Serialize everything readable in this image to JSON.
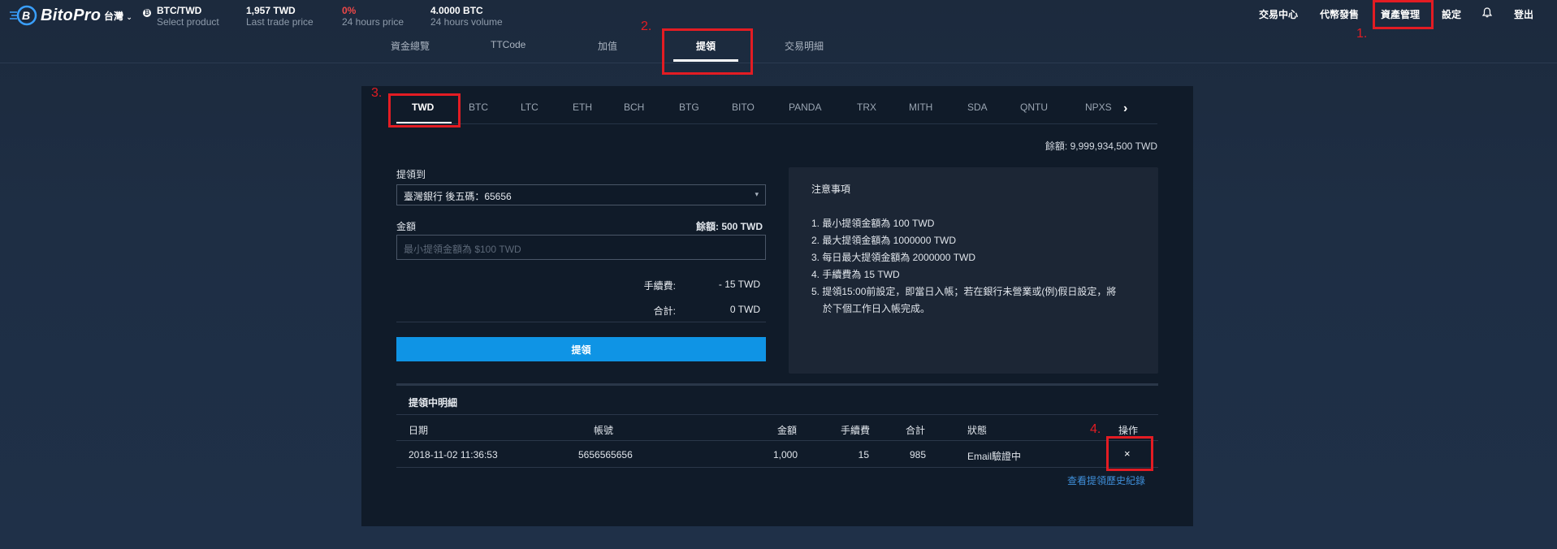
{
  "header": {
    "brand": "BitoPro",
    "region": "台灣",
    "pair": "BTC/TWD",
    "pair_sub": "Select product",
    "last_trade_value": "1,957 TWD",
    "last_trade_label": "Last trade price",
    "change_value": "0%",
    "change_label": "24 hours price",
    "volume_value": "4.0000 BTC",
    "volume_label": "24 hours volume",
    "nav": [
      "交易中心",
      "代幣發售",
      "資產管理",
      "設定",
      "登出"
    ]
  },
  "subnav": [
    "資金總覽",
    "TTCode",
    "加值",
    "提領",
    "交易明細"
  ],
  "coin_tabs": [
    "TWD",
    "BTC",
    "LTC",
    "ETH",
    "BCH",
    "BTG",
    "BITO",
    "PANDA",
    "TRX",
    "MITH",
    "SDA",
    "QNTU",
    "NPXS"
  ],
  "balance_total": "餘額: 9,999,934,500 TWD",
  "form": {
    "withdraw_to_label": "提領到",
    "bank_value": "臺灣銀行 後五碼：65656",
    "amount_label": "金額",
    "amount_balance": "餘額: 500 TWD",
    "amount_placeholder": "最小提領金額為 $100 TWD",
    "fee_label": "手續費:",
    "fee_value": "- 15 TWD",
    "total_label": "合計:",
    "total_value": "0 TWD",
    "submit_label": "提領"
  },
  "notice": {
    "title": "注意事項",
    "items": [
      "1. 最小提領金額為 100 TWD",
      "2. 最大提領金額為 1000000 TWD",
      "3. 每日最大提領金額為 2000000 TWD",
      "4. 手續費為 15 TWD",
      "5. 提領15:00前設定，即當日入帳；若在銀行未營業或(例)假日設定，將",
      "於下個工作日入帳完成。"
    ]
  },
  "pending": {
    "title": "提領中明細",
    "columns": [
      "日期",
      "帳號",
      "金額",
      "手續費",
      "合計",
      "狀態",
      "操作"
    ],
    "rows": [
      {
        "date": "2018-11-02 11:36:53",
        "account": "5656565656",
        "amount": "1,000",
        "fee": "15",
        "total": "985",
        "status": "Email驗證中",
        "action": "×"
      }
    ],
    "history_link": "查看提領歷史紀錄"
  },
  "annotations": [
    "1.",
    "2.",
    "3.",
    "4."
  ],
  "colors": {
    "accent": "#0f94e5",
    "highlight": "#e31c23",
    "link": "#3f8fd9",
    "negative": "#f04848"
  }
}
